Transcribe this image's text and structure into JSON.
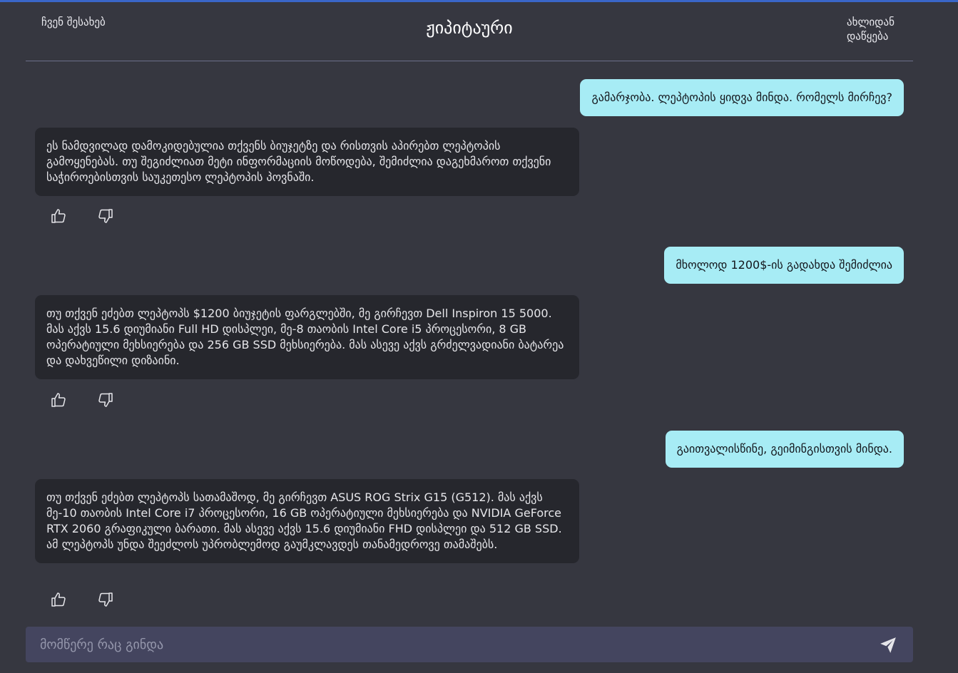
{
  "header": {
    "about_label": "ჩვენ შესახებ",
    "title": "ჟიპიტაური",
    "restart_label": "ახლიდან დაწყება"
  },
  "messages": [
    {
      "role": "user",
      "text": "გამარჯობა. ლეპტოპის ყიდვა მინდა. რომელს მირჩევ?"
    },
    {
      "role": "bot",
      "text": "ეს ნამდვილად დამოკიდებულია თქვენს ბიუჯეტზე და რისთვის აპირებთ ლეპტოპის გამოყენებას. თუ შეგიძლიათ მეტი ინფორმაციის მოწოდება, შემიძლია დაგეხმაროთ თქვენი საჭიროებისთვის საუკეთესო ლეპტოპის პოვნაში."
    },
    {
      "role": "user",
      "text": "მხოლოდ 1200$-ის გადახდა შემიძლია"
    },
    {
      "role": "bot",
      "text": "თუ თქვენ ეძებთ ლეპტოპს $1200 ბიუჯეტის ფარგლებში, მე გირჩევთ Dell Inspiron 15 5000. მას აქვს 15.6 დიუმიანი Full HD დისპლეი, მე-8 თაობის Intel Core i5 პროცესორი, 8 GB ოპერატიული მეხსიერება და 256 GB SSD მეხსიერება. მას ასევე აქვს გრძელვადიანი ბატარეა და დახვეწილი დიზაინი."
    },
    {
      "role": "user",
      "text": "გაითვალისწინე, გეიმინგისთვის მინდა."
    },
    {
      "role": "bot",
      "text": "თუ თქვენ ეძებთ ლეპტოპს სათამაშოდ, მე გირჩევთ ASUS ROG Strix G15 (G512). მას აქვს მე-10 თაობის Intel Core i7 პროცესორი, 16 GB ოპერატიული მეხსიერება და NVIDIA GeForce RTX 2060 გრაფიკული ბარათი. მას ასევე აქვს 15.6 დიუმიანი FHD დისპლეი და 512 GB SSD. ამ ლეპტოპს უნდა შეეძლოს უპრობლემოდ გაუმკლავდეს თანამედროვე თამაშებს."
    }
  ],
  "icons": {
    "like": "thumbs-up-icon",
    "dislike": "thumbs-down-icon",
    "send": "send-icon"
  },
  "composer": {
    "placeholder": "მომწერე რაც გინდა",
    "value": ""
  },
  "colors": {
    "background": "#363740",
    "accent_bar": "#3a66c8",
    "user_bubble": "#a7ecf5",
    "bot_bubble": "#26272d",
    "composer": "#44455f"
  }
}
